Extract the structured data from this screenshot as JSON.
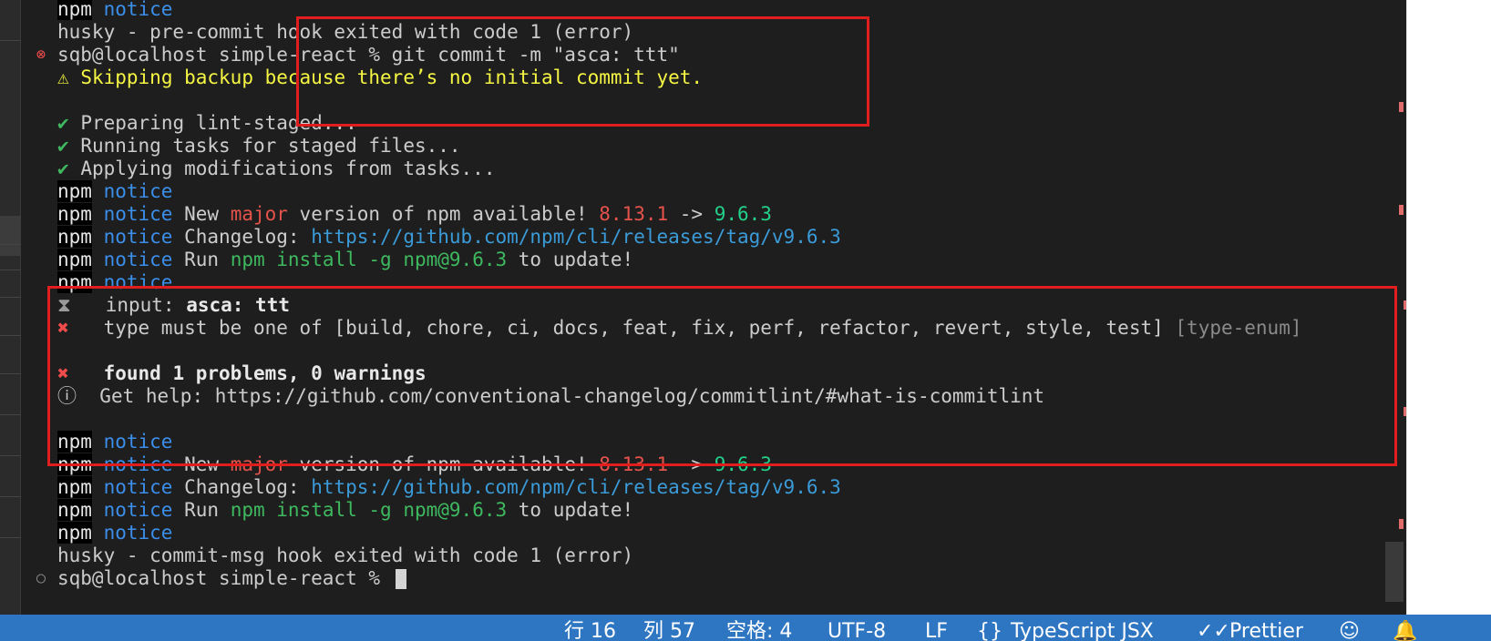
{
  "terminal": {
    "lines": {
      "l0": {
        "npm": "npm",
        "notice": "notice"
      },
      "l1": {
        "text": "husky - pre-commit hook exited with code 1 (error)"
      },
      "l2": {
        "prompt": "sqb@localhost simple-react % ",
        "cmd": "git commit -m \"asca: ttt\""
      },
      "l3": {
        "icon": "⚠",
        "text": "Skipping backup because there’s no initial commit yet."
      },
      "l4": {
        "check": "✔",
        "text": "Preparing lint-staged..."
      },
      "l5": {
        "check": "✔",
        "text": "Running tasks for staged files..."
      },
      "l6": {
        "check": "✔",
        "text": "Applying modifications from tasks..."
      },
      "l7": {
        "npm": "npm",
        "notice": "notice"
      },
      "l8": {
        "npm": "npm",
        "notice": "notice",
        "t1": "New ",
        "major": "major",
        "t2": " version of npm available! ",
        "old": "8.13.1",
        "arrow": " -> ",
        "new": "9.6.3"
      },
      "l9": {
        "npm": "npm",
        "notice": "notice",
        "t1": "Changelog: ",
        "url": "https://github.com/npm/cli/releases/tag/v9.6.3"
      },
      "l10": {
        "npm": "npm",
        "notice": "notice",
        "t1": "Run ",
        "cmd": "npm install -g npm@9.6.3",
        "t2": " to update!"
      },
      "l11": {
        "npm": "npm",
        "notice": "notice"
      },
      "l12": {
        "icon": "⧗",
        "label": "input: ",
        "value": "asca: ttt"
      },
      "l13": {
        "icon": "✖",
        "text": "type must be one of [build, chore, ci, docs, feat, fix, perf, refactor, revert, style, test] ",
        "rule": "[type-enum]"
      },
      "l14": {
        "icon": "✖",
        "text": "found 1 problems, 0 warnings"
      },
      "l15": {
        "icon": "ⓘ",
        "text": "Get help: https://github.com/conventional-changelog/commitlint/#what-is-commitlint"
      },
      "l16": {
        "npm": "npm",
        "notice": "notice"
      },
      "l17": {
        "npm": "npm",
        "notice": "notice",
        "t1": "New ",
        "major": "major",
        "t2": " version of npm available! ",
        "old": "8.13.1",
        "arrow": " -> ",
        "new": "9.6.3"
      },
      "l18": {
        "npm": "npm",
        "notice": "notice",
        "t1": "Changelog: ",
        "url": "https://github.com/npm/cli/releases/tag/v9.6.3"
      },
      "l19": {
        "npm": "npm",
        "notice": "notice",
        "t1": "Run ",
        "cmd": "npm install -g npm@9.6.3",
        "t2": " to update!"
      },
      "l20": {
        "npm": "npm",
        "notice": "notice"
      },
      "l21": {
        "text": "husky - commit-msg hook exited with code 1 (error)"
      },
      "l22": {
        "prompt": "sqb@localhost simple-react % "
      }
    },
    "gutter_error_icon": "⊗",
    "gutter_idle_icon": "○"
  },
  "statusbar": {
    "line_col_line": "行 16",
    "line_col_col": "列 57",
    "indent": "空格: 4",
    "encoding": "UTF-8",
    "eol": "LF",
    "language_icon": "{}",
    "language": "TypeScript JSX",
    "prettier_icon": "✓✓",
    "prettier": "Prettier",
    "feedback_icon": "☺",
    "bell_icon": "🔔"
  },
  "colors": {
    "terminal_bg": "#1e1e1e",
    "statusbar_bg": "#2f76c2",
    "highlight_box": "#e01e1e"
  }
}
